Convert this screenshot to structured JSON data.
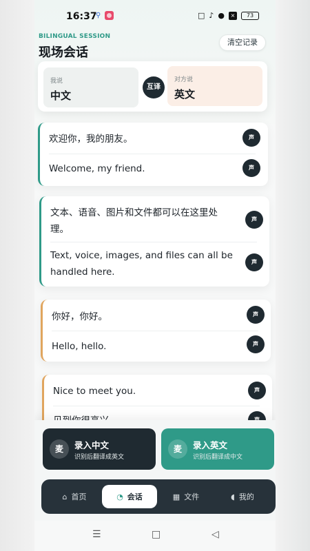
{
  "status": {
    "time": "16:37",
    "battery": "73",
    "left_icons": [
      "search-icon",
      "app-icon"
    ],
    "right_icons": [
      "nfc-icon",
      "mute-icon",
      "wifi-icon",
      "sim-icon",
      "battery-icon"
    ]
  },
  "header": {
    "tag": "BILINGUAL SESSION",
    "title": "现场会话",
    "clear_label": "清空记录"
  },
  "languages": {
    "me_caption": "我说",
    "me_lang": "中文",
    "swap_label": "互译",
    "other_caption": "对方说",
    "other_lang": "英文"
  },
  "voice_label": "声",
  "messages": [
    {
      "side": "me",
      "source": "欢迎你，我的朋友。",
      "translation": "Welcome, my friend."
    },
    {
      "side": "me",
      "source_lines": [
        "文本、语音、图片和文件都可以在这里处",
        "理。"
      ],
      "translation_lines": [
        "Text, voice, images, and files can all be",
        "handled here."
      ]
    },
    {
      "side": "other",
      "source": "你好，你好。",
      "translation": "Hello, hello."
    },
    {
      "side": "other",
      "source": "Nice to meet you.",
      "translation": "见到你很高兴。"
    }
  ],
  "actions": {
    "record_cn": {
      "icon_label": "麦",
      "title": "录入中文",
      "subtitle": "识别后翻译成英文"
    },
    "record_en": {
      "icon_label": "麦",
      "title": "录入英文",
      "subtitle": "识别后翻译成中文"
    }
  },
  "nav": {
    "items": [
      {
        "icon": "home-icon",
        "label": "首页"
      },
      {
        "icon": "chat-icon",
        "label": "会话",
        "active": true
      },
      {
        "icon": "file-icon",
        "label": "文件"
      },
      {
        "icon": "user-icon",
        "label": "我的"
      }
    ]
  },
  "colors": {
    "accent_teal": "#2f9a88",
    "accent_orange": "#e0a55e",
    "dark": "#1f2a31"
  }
}
